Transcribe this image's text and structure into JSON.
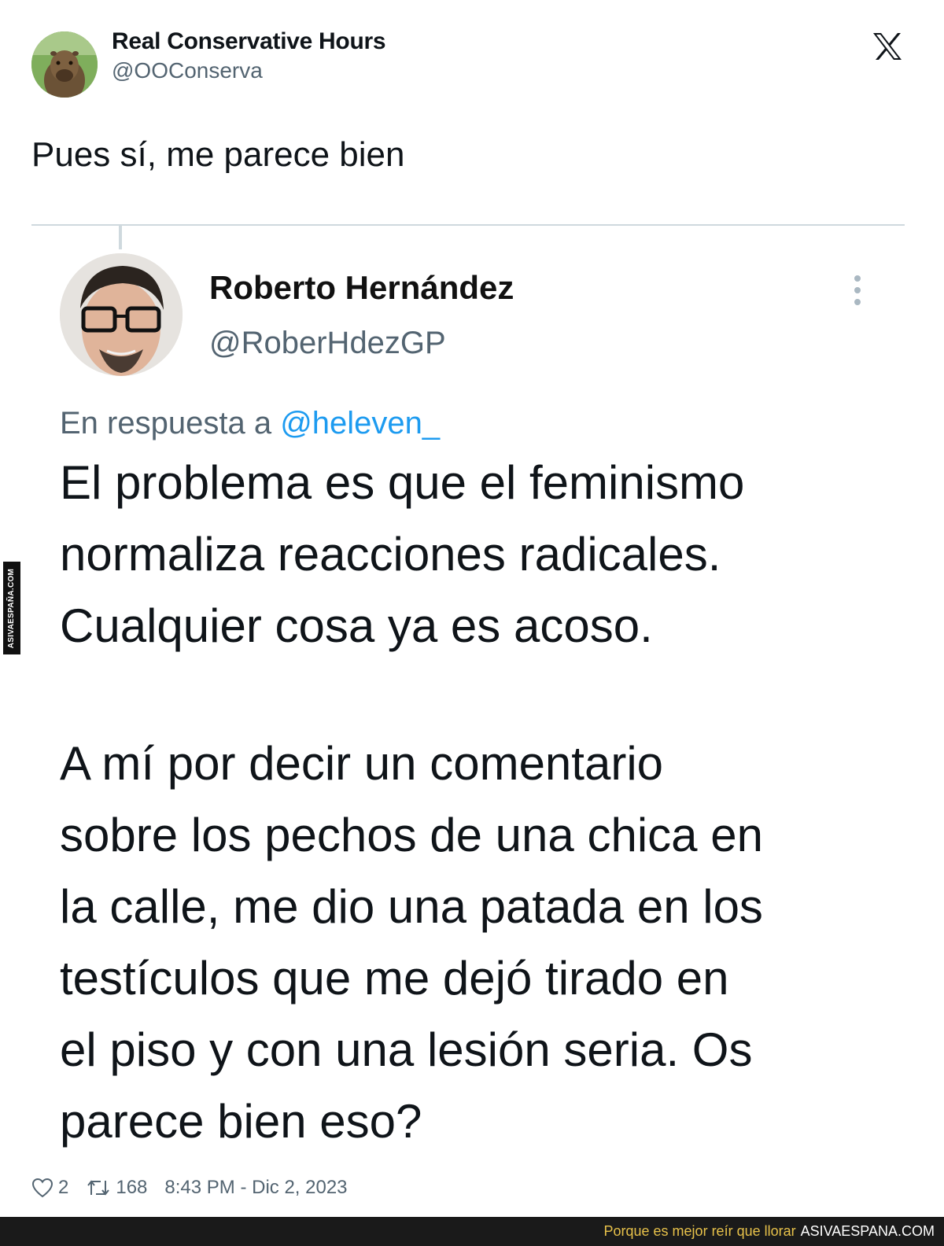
{
  "outer_tweet": {
    "author_name": "Real Conservative Hours",
    "handle": "@OOConserva",
    "text": "Pues sí, me parece bien",
    "platform_icon": "x-logo-icon"
  },
  "quoted_screenshot": {
    "author_name": "Roberto Hernández",
    "handle": "@RoberHdezGP",
    "reply_prefix": "En respuesta a",
    "reply_mention": "@heleven_",
    "paragraph_1": "El problema es que el feminismo\nnormaliza reacciones radicales.\nCualquier cosa ya es acoso.",
    "paragraph_2": "A mí por decir un comentario\nsobre los pechos de una chica en\nla calle, me dio una patada en los\ntestículos que me dejó tirado en\nel piso y con una lesión seria. Os\nparece bien eso?",
    "menu_icon": "more-vertical-icon"
  },
  "stats": {
    "likes": "2",
    "retweets": "168",
    "timestamp": "8:43 PM - Dic 2, 2023"
  },
  "watermark": {
    "side_text": "ASIVAESPAÑA.COM",
    "banner_slogan": "Porque es mejor reír que llorar",
    "banner_site": "ASIVAESPANA.COM"
  },
  "colors": {
    "text": "#0f1419",
    "secondary": "#536471",
    "link": "#1d9bf0",
    "banner_background": "#1a1a1a",
    "banner_slogan": "#e7c14a"
  }
}
